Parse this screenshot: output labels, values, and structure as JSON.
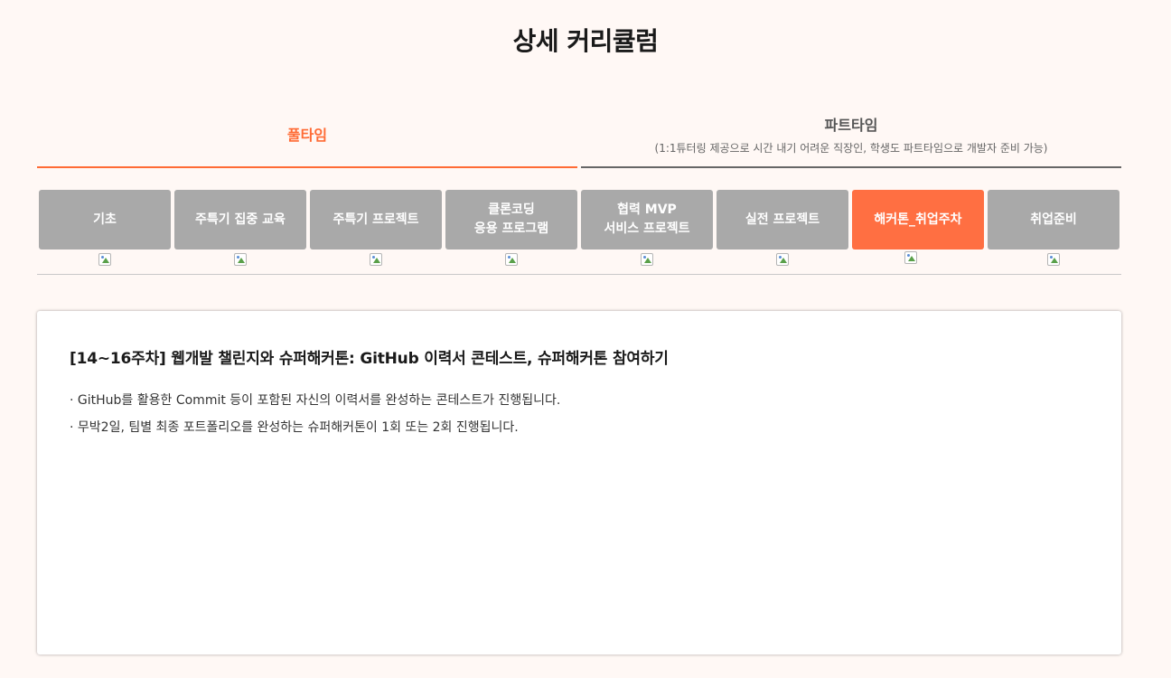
{
  "page": {
    "title": "상세 커리큘럼"
  },
  "mode_tabs": [
    {
      "label": "풀타임",
      "sub": "",
      "active": true
    },
    {
      "label": "파트타임",
      "sub": "(1:1튜터링 제공으로 시간 내기 어려운 직장인, 학생도 파트타임으로 개발자 준비 가능)",
      "active": false
    }
  ],
  "week_tabs": [
    {
      "label": "기초",
      "active": false
    },
    {
      "label": "주특기 집중 교육",
      "active": false
    },
    {
      "label": "주특기 프로젝트",
      "active": false
    },
    {
      "label": "클론코딩\n응용 프로그램",
      "active": false
    },
    {
      "label": "협력 MVP\n서비스 프로젝트",
      "active": false
    },
    {
      "label": "실전 프로젝트",
      "active": false
    },
    {
      "label": "해커톤_취업주차",
      "active": true
    },
    {
      "label": "취업준비",
      "active": false
    }
  ],
  "detail": {
    "title": "[14~16주차] 웹개발 챌린지와 슈퍼해커톤: GitHub 이력서 콘테스트, 슈퍼해커톤 참여하기",
    "lines": [
      "· GitHub를 활용한 Commit 등이 포함된 자신의 이력서를 완성하는 콘테스트가 진행됩니다.",
      "· 무박2일, 팀별 최종 포트폴리오를 완성하는 슈퍼해커톤이 1회 또는 2회 진행됩니다."
    ]
  },
  "colors": {
    "accent": "#ff6b35",
    "tab_inactive": "#a9a9a9",
    "background": "#fff8f5"
  },
  "icons": {
    "week_indicator": "broken-image-icon"
  }
}
